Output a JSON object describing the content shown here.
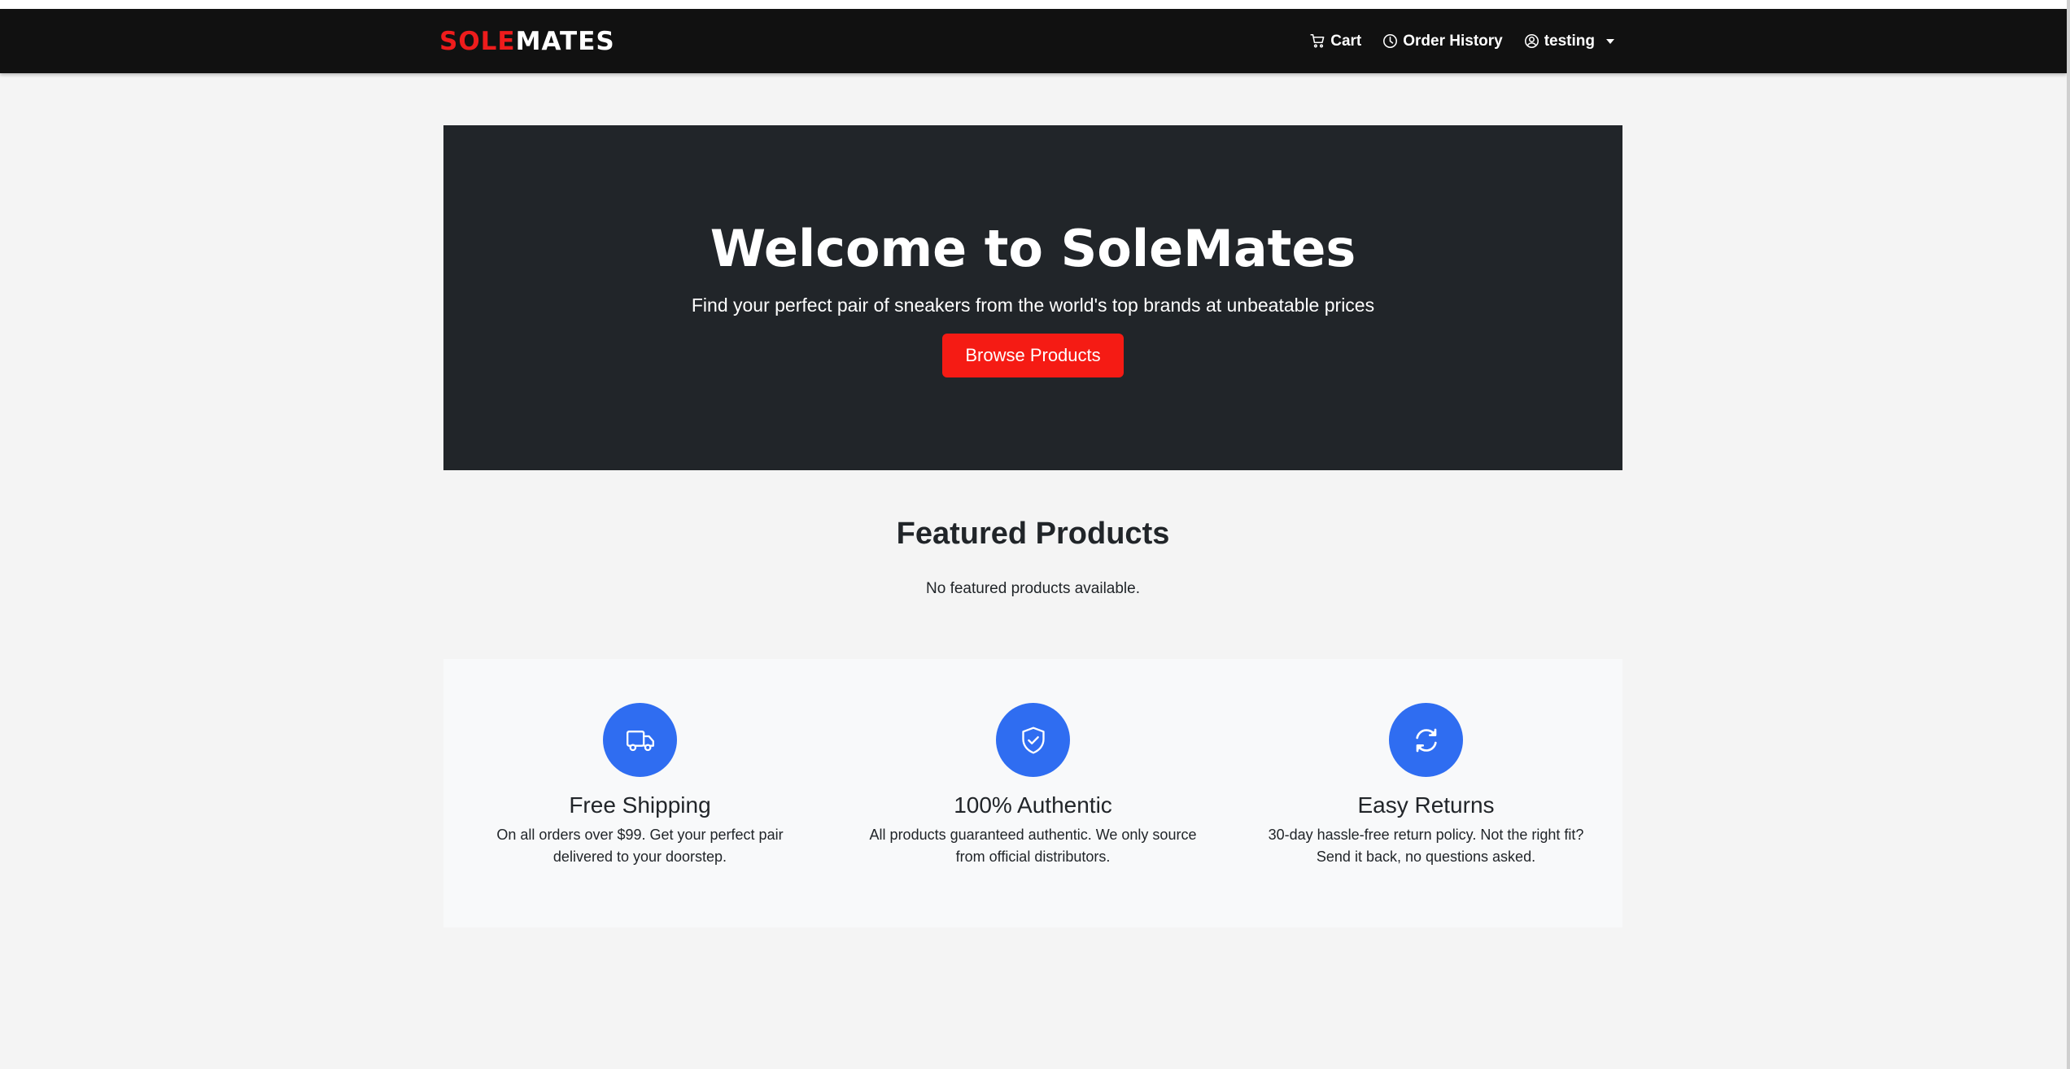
{
  "nav": {
    "brand_part1": "SOLE",
    "brand_part2": "MATES",
    "cart_label": "Cart",
    "order_history_label": "Order History",
    "user_label": "testing"
  },
  "hero": {
    "title": "Welcome to SoleMates",
    "subtitle": "Find your perfect pair of sneakers from the world's top brands at unbeatable prices",
    "cta_label": "Browse Products"
  },
  "featured": {
    "title": "Featured Products",
    "empty_message": "No featured products available."
  },
  "features": [
    {
      "icon": "truck-icon",
      "title": "Free Shipping",
      "description": "On all orders over $99. Get your perfect pair delivered to your doorstep."
    },
    {
      "icon": "shield-check-icon",
      "title": "100% Authentic",
      "description": "All products guaranteed authentic. We only source from official distributors."
    },
    {
      "icon": "refresh-icon",
      "title": "Easy Returns",
      "description": "30-day hassle-free return policy. Not the right fit? Send it back, no questions asked."
    }
  ],
  "colors": {
    "brand_red": "#ee1c1c",
    "navbar_bg": "#111111",
    "hero_bg": "#212529",
    "cta_bg": "#f51b14",
    "feature_icon_bg": "#2f6df1"
  }
}
